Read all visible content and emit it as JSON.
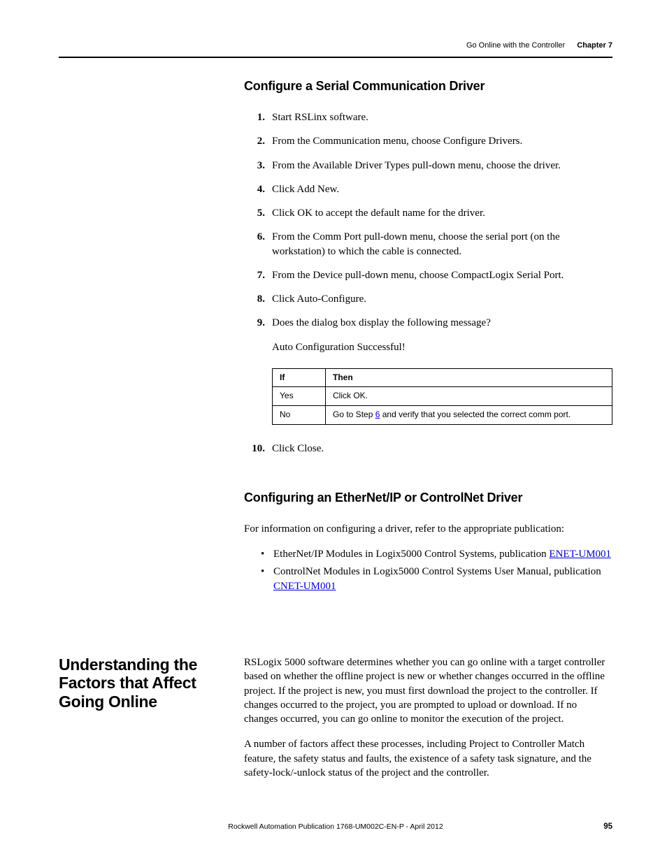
{
  "header": {
    "running": "Go Online with the Controller",
    "chapter": "Chapter 7"
  },
  "section1": {
    "title": "Configure a Serial Communication Driver",
    "steps": [
      "Start RSLinx software.",
      "From the Communication menu, choose Configure Drivers.",
      "From the Available Driver Types pull-down menu, choose the driver.",
      "Click Add New.",
      "Click OK to accept the default name for the driver.",
      "From the Comm Port pull-down menu, choose the serial port (on the workstation) to which the cable is connected.",
      "From the Device pull-down menu, choose CompactLogix Serial Port.",
      "Click Auto-Configure.",
      "Does the dialog box display the following message?"
    ],
    "step9_sub": "Auto Configuration Successful!",
    "table": {
      "h1": "If",
      "h2": "Then",
      "rows": [
        {
          "c1": "Yes",
          "c2": "Click OK."
        },
        {
          "c1": "No",
          "c2_pre": "Go to Step ",
          "c2_link": "6",
          "c2_post": " and verify that you selected the correct comm port."
        }
      ]
    },
    "step10_num": "10.",
    "step10_txt": "Click Close."
  },
  "section2": {
    "title": "Configuring an EtherNet/IP or ControlNet Driver",
    "intro": "For information on configuring a driver, refer to the appropriate publication:",
    "bullets": [
      {
        "pre": "EtherNet/IP Modules in Logix5000 Control Systems, publication ",
        "link": "ENET-UM001"
      },
      {
        "pre": "ControlNet Modules in Logix5000 Control Systems User Manual, publication ",
        "link": "CNET-UM001"
      }
    ]
  },
  "section3": {
    "side_title": "Understanding the Factors that Affect Going Online",
    "p1": "RSLogix 5000 software determines whether you can go online with a target controller based on whether the offline project is new or whether changes occurred in the offline project. If the project is new, you must first download the project to the controller. If changes occurred to the project, you are prompted to upload or download. If no changes occurred, you can go online to monitor the execution of the project.",
    "p2": "A number of factors affect these processes, including Project to Controller Match feature, the safety status and faults, the existence of a safety task signature, and the safety-lock/-unlock status of the project and the controller."
  },
  "footer": {
    "pub": "Rockwell Automation Publication 1768-UM002C-EN-P - April 2012",
    "page": "95"
  }
}
